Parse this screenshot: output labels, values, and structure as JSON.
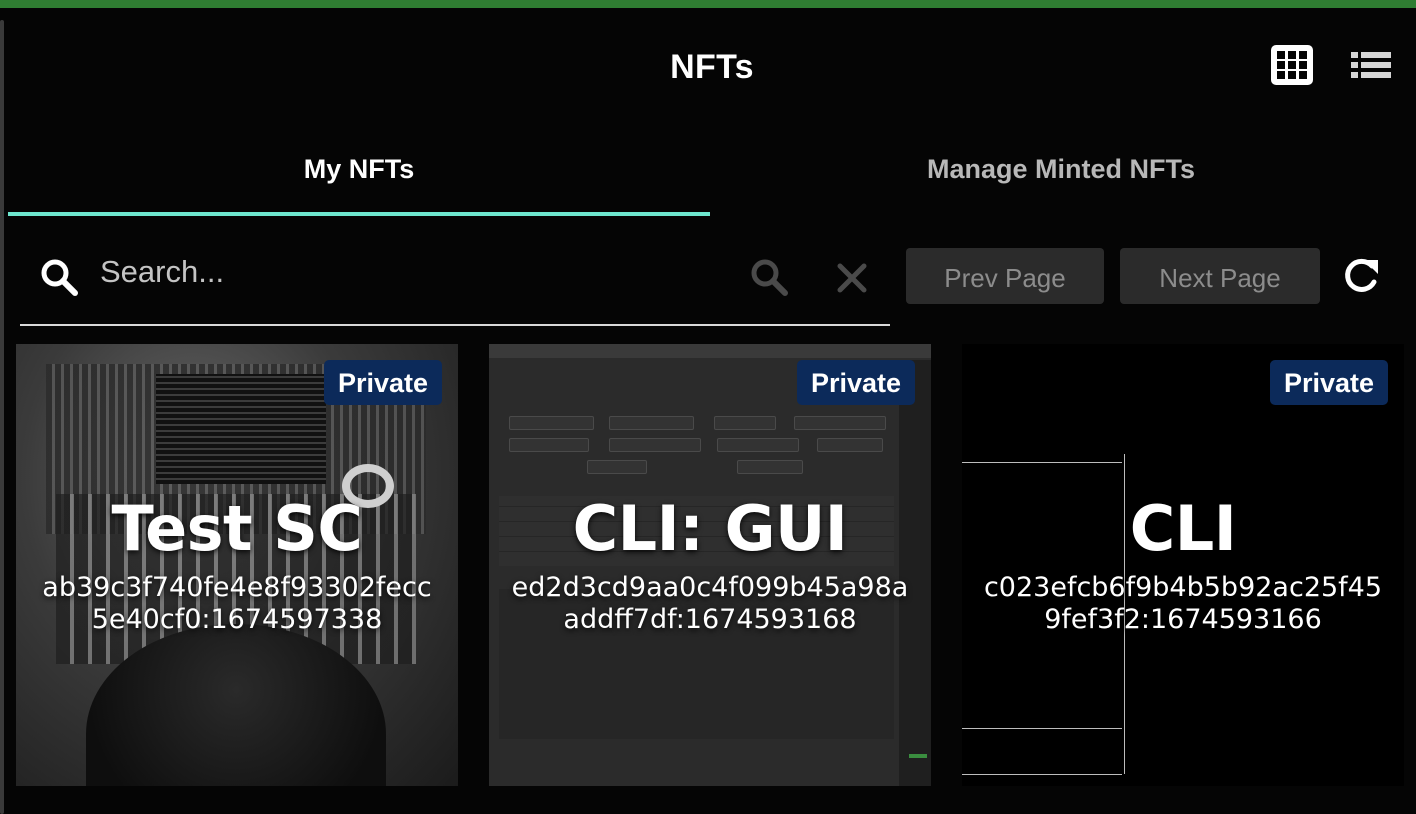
{
  "header": {
    "title": "NFTs",
    "grid_view_icon": "grid-icon",
    "list_view_icon": "list-icon"
  },
  "tabs": [
    {
      "label": "My NFTs",
      "active": true
    },
    {
      "label": "Manage Minted NFTs",
      "active": false
    }
  ],
  "search": {
    "placeholder": "Search...",
    "value": ""
  },
  "pagination": {
    "prev_label": "Prev Page",
    "next_label": "Next Page"
  },
  "colors": {
    "accent": "#6ee7cf",
    "top_strip": "#2f7d32",
    "badge_bg": "#0c2a5a"
  },
  "nfts": [
    {
      "name": "Test SC",
      "id": "ab39c3f740fe4e8f93302fecc5e40cf0:1674597338",
      "badge": "Private"
    },
    {
      "name": "CLI: GUI",
      "id": "ed2d3cd9aa0c4f099b45a98aaddff7df:1674593168",
      "badge": "Private"
    },
    {
      "name": "CLI",
      "id": "c023efcb6f9b4b5b92ac25f459fef3f2:1674593166",
      "badge": "Private"
    }
  ]
}
